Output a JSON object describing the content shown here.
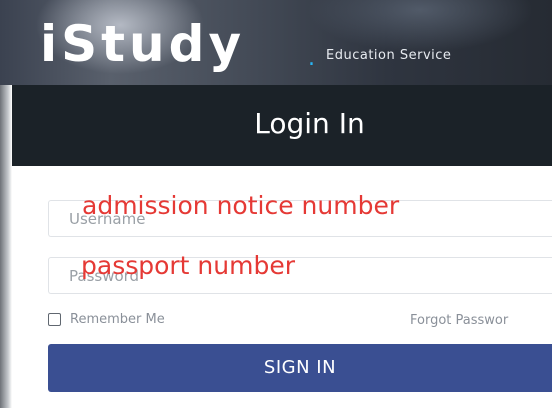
{
  "brand": {
    "logo_text": "iStudy",
    "dot": ".",
    "tagline": "Education Service"
  },
  "login": {
    "title": "Login In",
    "username_placeholder": "Username",
    "password_placeholder": "Password",
    "remember_label": "Remember Me",
    "forgot_label": "Forgot Passwor",
    "signin_label": "SIGN IN"
  },
  "annotations": {
    "username_note": "admission notice number",
    "password_note": "passport number",
    "color": "#e53935"
  },
  "colors": {
    "header_bg": "#1b2228",
    "button_bg": "#3a4f92",
    "accent_dot": "#29b6f6"
  }
}
